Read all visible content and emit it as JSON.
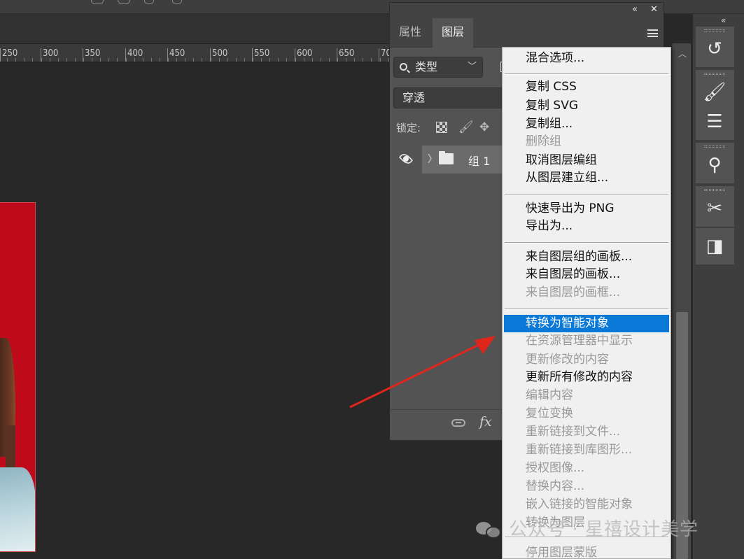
{
  "ruler": {
    "ticks": [
      "250",
      "300",
      "350",
      "400",
      "450",
      "500",
      "550",
      "600",
      "650",
      "70"
    ]
  },
  "panel": {
    "tabs": [
      "属性",
      "图层"
    ],
    "active_tab": "图层",
    "collapse_label": "«",
    "close_label": "✕",
    "kind_filter": "类型",
    "blend_mode": "穿透",
    "lock_label": "锁定:",
    "layer": {
      "name": "组 1",
      "twisty": "〉"
    },
    "footer": {
      "fx_label": "fx"
    }
  },
  "toolstrip": {
    "collapse_label": "«"
  },
  "context_menu": {
    "items": [
      {
        "label": "混合选项...",
        "disabled": false
      },
      {
        "label": "复制 CSS",
        "disabled": false
      },
      {
        "label": "复制 SVG",
        "disabled": false
      },
      {
        "label": "复制组...",
        "disabled": false
      },
      {
        "label": "删除组",
        "disabled": true
      },
      {
        "label": "取消图层编组",
        "disabled": false
      },
      {
        "label": "从图层建立组...",
        "disabled": false
      },
      {
        "label": "快速导出为 PNG",
        "disabled": false
      },
      {
        "label": "导出为...",
        "disabled": false
      },
      {
        "label": "来自图层组的画板...",
        "disabled": false
      },
      {
        "label": "来自图层的画板...",
        "disabled": false
      },
      {
        "label": "来自图层的画框...",
        "disabled": true
      },
      {
        "label": "转换为智能对象",
        "disabled": false,
        "highlighted": true
      },
      {
        "label": "在资源管理器中显示",
        "disabled": true
      },
      {
        "label": "更新修改的内容",
        "disabled": true
      },
      {
        "label": "更新所有修改的内容",
        "disabled": false
      },
      {
        "label": "编辑内容",
        "disabled": true
      },
      {
        "label": "复位变换",
        "disabled": true
      },
      {
        "label": "重新链接到文件...",
        "disabled": true
      },
      {
        "label": "重新链接到库图形...",
        "disabled": true
      },
      {
        "label": "授权图像...",
        "disabled": true
      },
      {
        "label": "替换内容...",
        "disabled": true
      },
      {
        "label": "嵌入链接的智能对象",
        "disabled": true
      },
      {
        "label": "转换为图层",
        "disabled": true
      },
      {
        "label": "停用图层蒙版",
        "disabled": true
      }
    ]
  },
  "colors": {
    "highlight": "#0a78d7",
    "arrow": "#e0251b",
    "artboard": "#bf0a1c"
  },
  "watermark": {
    "text": "公众号 · 星禧设计美学"
  }
}
